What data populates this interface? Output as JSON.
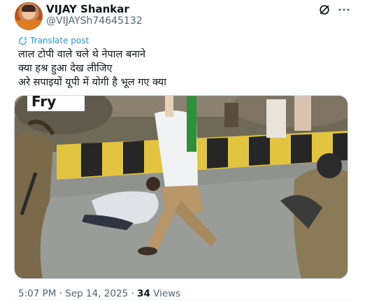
{
  "author": {
    "display_name": "VIJAY Shankar",
    "handle": "@VIJAYSh74645132"
  },
  "actions": {
    "grok_icon": "grok-icon",
    "more_icon": "more-horizontal-icon"
  },
  "translate": {
    "label": "Translate post"
  },
  "post": {
    "lines": [
      "लाल टोपी वाले चले थे नेपाल बनाने",
      "क्या हश्र हुआ देख लीजिए",
      "अरे सपाइयों यूपी में योगी है भूल गए क्या"
    ]
  },
  "media": {
    "type": "video",
    "overlay_text": "Fry"
  },
  "meta": {
    "time": "5:07 PM",
    "separator": "·",
    "date": "Sep 14, 2025",
    "views_count": "34",
    "views_label": "Views"
  },
  "colors": {
    "accent": "#1d9bf0",
    "text_primary": "#0f1419",
    "text_secondary": "#536471"
  }
}
